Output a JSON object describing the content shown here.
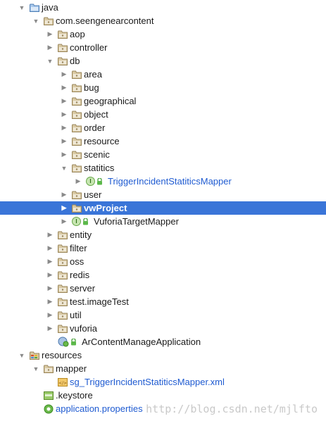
{
  "tree": {
    "nodes": [
      {
        "label": "java",
        "indent": 0,
        "arrow": "down",
        "icon": "source-folder-icon"
      },
      {
        "label": "com.seengenearcontent",
        "indent": 1,
        "arrow": "down",
        "icon": "folder-icon"
      },
      {
        "label": "aop",
        "indent": 2,
        "arrow": "right",
        "icon": "folder-icon"
      },
      {
        "label": "controller",
        "indent": 2,
        "arrow": "right",
        "icon": "folder-icon"
      },
      {
        "label": "db",
        "indent": 2,
        "arrow": "down",
        "icon": "folder-icon"
      },
      {
        "label": "area",
        "indent": 3,
        "arrow": "right",
        "icon": "folder-icon"
      },
      {
        "label": "bug",
        "indent": 3,
        "arrow": "right",
        "icon": "folder-icon"
      },
      {
        "label": "geographical",
        "indent": 3,
        "arrow": "right",
        "icon": "folder-icon"
      },
      {
        "label": "object",
        "indent": 3,
        "arrow": "right",
        "icon": "folder-icon"
      },
      {
        "label": "order",
        "indent": 3,
        "arrow": "right",
        "icon": "folder-icon"
      },
      {
        "label": "resource",
        "indent": 3,
        "arrow": "right",
        "icon": "folder-icon"
      },
      {
        "label": "scenic",
        "indent": 3,
        "arrow": "right",
        "icon": "folder-icon"
      },
      {
        "label": "statitics",
        "indent": 3,
        "arrow": "down",
        "icon": "folder-icon"
      },
      {
        "label": "TriggerIncidentStatiticsMapper",
        "indent": 4,
        "arrow": "right",
        "icon": "interface-icon",
        "blue": true
      },
      {
        "label": "user",
        "indent": 3,
        "arrow": "right",
        "icon": "folder-icon"
      },
      {
        "label": "vwProject",
        "indent": 3,
        "arrow": "right",
        "icon": "folder-icon",
        "selected": true
      },
      {
        "label": "VuforiaTargetMapper",
        "indent": 3,
        "arrow": "right",
        "icon": "interface-icon"
      },
      {
        "label": "entity",
        "indent": 2,
        "arrow": "right",
        "icon": "folder-icon"
      },
      {
        "label": "filter",
        "indent": 2,
        "arrow": "right",
        "icon": "folder-icon"
      },
      {
        "label": "oss",
        "indent": 2,
        "arrow": "right",
        "icon": "folder-icon"
      },
      {
        "label": "redis",
        "indent": 2,
        "arrow": "right",
        "icon": "folder-icon"
      },
      {
        "label": "server",
        "indent": 2,
        "arrow": "right",
        "icon": "folder-icon"
      },
      {
        "label": "test.imageTest",
        "indent": 2,
        "arrow": "right",
        "icon": "folder-icon"
      },
      {
        "label": "util",
        "indent": 2,
        "arrow": "right",
        "icon": "folder-icon"
      },
      {
        "label": "vuforia",
        "indent": 2,
        "arrow": "right",
        "icon": "folder-icon"
      },
      {
        "label": "ArContentManageApplication",
        "indent": 2,
        "arrow": "none",
        "icon": "spring-class-icon"
      },
      {
        "label": "resources",
        "indent": 0,
        "arrow": "down",
        "icon": "resources-folder-icon"
      },
      {
        "label": "mapper",
        "indent": 1,
        "arrow": "down",
        "icon": "folder-icon"
      },
      {
        "label": "sg_TriggerIncidentStatiticsMapper.xml",
        "indent": 2,
        "arrow": "none",
        "icon": "xml-file-icon",
        "blue": true
      },
      {
        "label": ".keystore",
        "indent": 1,
        "arrow": "none",
        "icon": "keystore-file-icon"
      },
      {
        "label": "application.properties",
        "indent": 1,
        "arrow": "none",
        "icon": "properties-file-icon",
        "blue": true
      }
    ]
  },
  "watermark": "http://blog.csdn.net/mjlfto",
  "colors": {
    "selection": "#3a75d8",
    "blue_text": "#1f5bd1",
    "folder": "#d9c9a3"
  }
}
